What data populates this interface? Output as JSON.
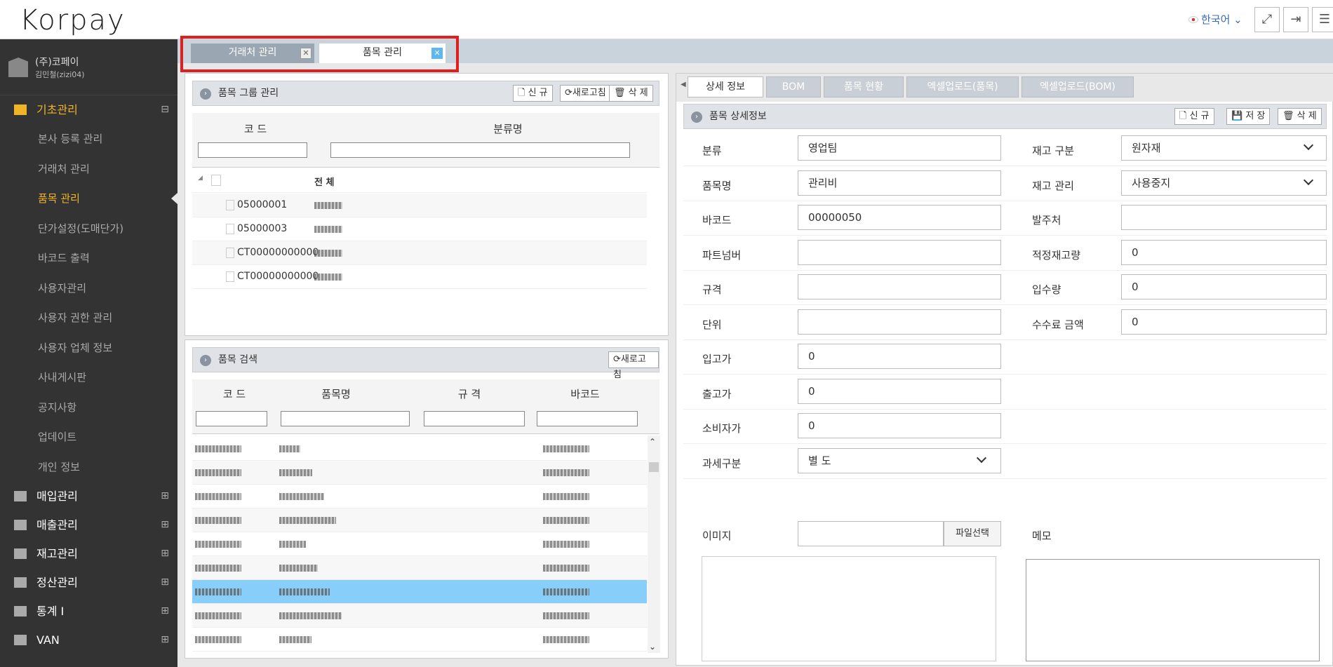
{
  "app": {
    "logo": "Korpay",
    "lang": "한국어"
  },
  "sidebar": {
    "company": "(주)코페이",
    "user": "김민철(zizi04)",
    "sections": [
      {
        "label": "기초관리",
        "pm": "⊟"
      },
      {
        "label": "매입관리",
        "pm": "⊞"
      },
      {
        "label": "매출관리",
        "pm": "⊞"
      },
      {
        "label": "재고관리",
        "pm": "⊞"
      },
      {
        "label": "정산관리",
        "pm": "⊞"
      },
      {
        "label": "통계 I",
        "pm": "⊞"
      },
      {
        "label": "VAN",
        "pm": "⊞"
      }
    ],
    "subitems": [
      "본사 등록 관리",
      "거래처 관리",
      "품목 관리",
      "단가설정(도매단가)",
      "바코드 출력",
      "사용자관리",
      "사용자 권한 관리",
      "사용자 업체 정보",
      "사내게시판",
      "공지사항",
      "업데이트",
      "개인 정보"
    ]
  },
  "tabs": [
    {
      "label": "거래처 관리"
    },
    {
      "label": "품목 관리"
    }
  ],
  "group_panel": {
    "title": "품목 그룹 관리",
    "btn_new": "신 규",
    "btn_refresh": "새로고침",
    "btn_delete": "삭 제",
    "col_code": "코 드",
    "col_name": "분류명",
    "root": "전 체",
    "rows": [
      {
        "code": "05000001"
      },
      {
        "code": "05000003"
      },
      {
        "code": "CT00000000000"
      },
      {
        "code": "CT00000000000"
      }
    ]
  },
  "search_panel": {
    "title": "품목 검색",
    "btn_refresh": "새로고침",
    "cols": [
      "코 드",
      "품목명",
      "규 격",
      "바코드"
    ]
  },
  "detail": {
    "tabs": [
      "상세 정보",
      "BOM",
      "품목 현황",
      "엑셀업로드(품목)",
      "엑셀업로드(BOM)"
    ],
    "title": "품목 상세정보",
    "btn_new": "신 규",
    "btn_save": "저 장",
    "btn_delete": "삭 제",
    "left": [
      {
        "label": "분류",
        "value": "영업팀"
      },
      {
        "label": "품목명",
        "value": "관리비"
      },
      {
        "label": "바코드",
        "value": "00000050"
      },
      {
        "label": "파트넘버",
        "value": ""
      },
      {
        "label": "규격",
        "value": ""
      },
      {
        "label": "단위",
        "value": ""
      },
      {
        "label": "입고가",
        "value": "0"
      },
      {
        "label": "출고가",
        "value": "0"
      },
      {
        "label": "소비자가",
        "value": "0"
      },
      {
        "label": "과세구분",
        "value": "별 도"
      }
    ],
    "right": [
      {
        "label": "재고 구분",
        "value": "원자재"
      },
      {
        "label": "재고 관리",
        "value": "사용중지"
      },
      {
        "label": "발주처",
        "value": ""
      },
      {
        "label": "적정재고량",
        "value": "0"
      },
      {
        "label": "입수량",
        "value": "0"
      },
      {
        "label": "수수료 금액",
        "value": "0"
      }
    ],
    "image_label": "이미지",
    "file_btn": "파일선택",
    "memo_label": "메모"
  }
}
